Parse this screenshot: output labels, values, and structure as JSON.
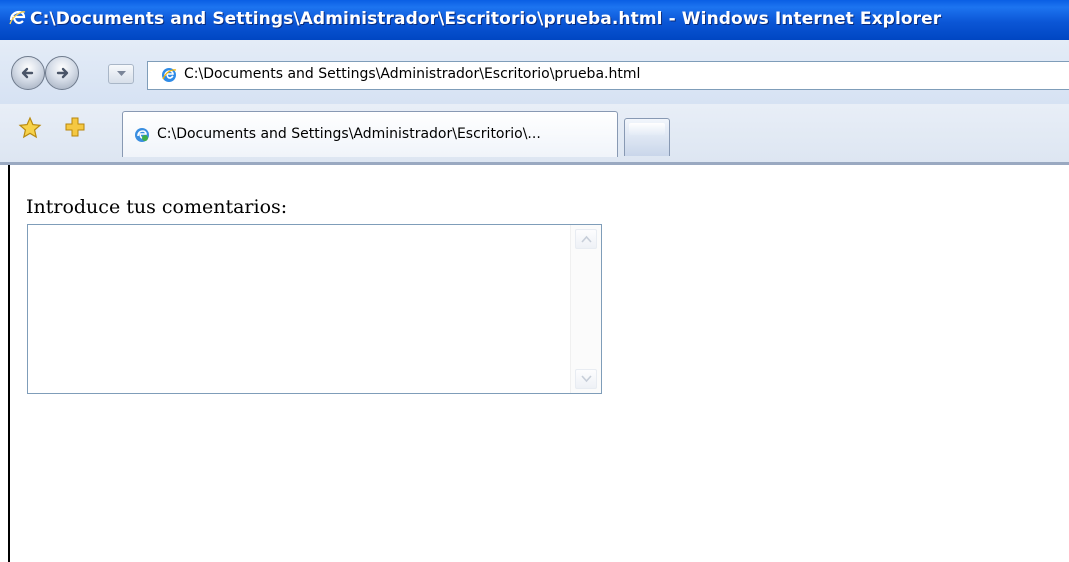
{
  "window": {
    "title": "C:\\Documents and Settings\\Administrador\\Escritorio\\prueba.html - Windows Internet Explorer"
  },
  "toolbar": {
    "back_icon": "back-arrow-icon",
    "forward_icon": "forward-arrow-icon",
    "dropdown_icon": "chevron-down-icon"
  },
  "address_bar": {
    "value": "C:\\Documents and Settings\\Administrador\\Escritorio\\prueba.html",
    "icon": "ie-page-icon"
  },
  "tabs": [
    {
      "label": "C:\\Documents and Settings\\Administrador\\Escritorio\\...",
      "icon": "ie-tab-icon",
      "active": true
    }
  ],
  "favorites": {
    "star_icon": "favorites-star-icon",
    "add_icon": "add-favorite-icon"
  },
  "page": {
    "prompt": "Introduce tus comentarios:",
    "comments_value": ""
  },
  "colors": {
    "titlebar": "#0b56d6",
    "field_border": "#7f9db9"
  }
}
